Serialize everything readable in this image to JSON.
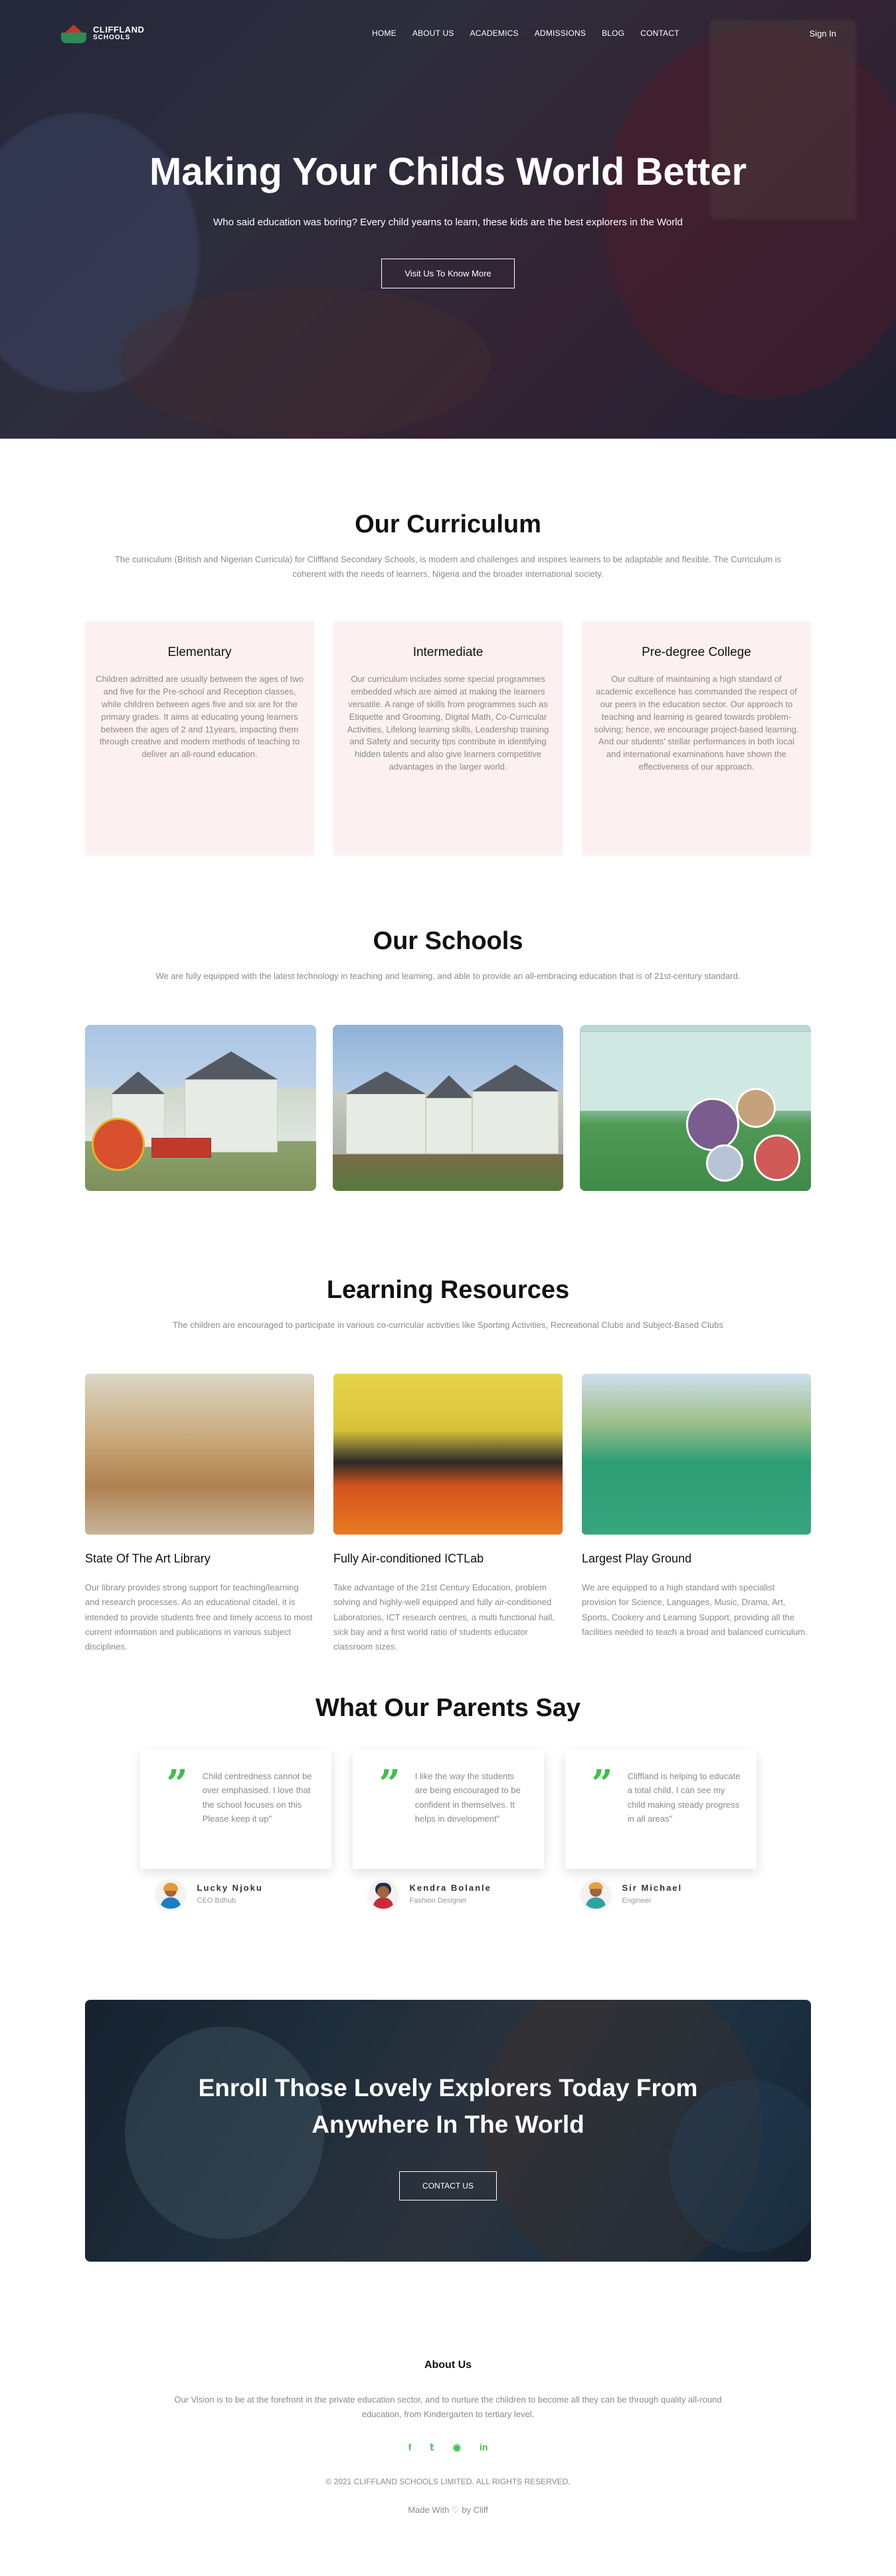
{
  "nav": {
    "logo_line1": "CLIFFLAND",
    "logo_line2": "SCHOOLS",
    "items": [
      "HOME",
      "ABOUT US",
      "ACADEMICS",
      "ADMISSIONS",
      "BLOG",
      "CONTACT"
    ],
    "signin": "Sign In"
  },
  "hero": {
    "title": "Making Your Childs World Better",
    "subtitle": "Who said education was boring? Every child yearns to learn, these kids are the best explorers in the World",
    "button": "Visit Us To Know More"
  },
  "curriculum": {
    "title": "Our Curriculum",
    "description": "The curriculum (British and Nigerian Curricula) for Cliffland Secondary Schools, is modern and challenges and inspires learners to be adaptable and flexible. The Curriculum is coherent with the needs of learners, Nigeria and the broader international society.",
    "cards": [
      {
        "title": "Elementary",
        "text": "Children admitted are usually between the ages of two and five for the Pre-school and Reception classes, while children between ages five and six are for the primary grades. It aims at educating young learners between the ages of 2 and 11years, impacting them through creative and modern methods of teaching to deliver an all-round education."
      },
      {
        "title": "Intermediate",
        "text": "Our curriculum includes some special programmes embedded which are aimed at making the learners versatile. A range of skills from programmes such as Etiquette and Grooming, Digital Math, Co-Curricular Activities, Lifelong learning skills, Leadership training and Safety and security tips contribute in identifying hidden talents and also give learners competitive advantages in the larger world."
      },
      {
        "title": "Pre-degree College",
        "text": "Our culture of maintaining a high standard of academic excellence has commanded the respect of our peers in the education sector. Our approach to teaching and learning is geared towards problem-solving; hence, we encourage project-based learning. And our students' stellar performances in both local and international examinations have shown the effectiveness of our approach."
      }
    ]
  },
  "schools": {
    "title": "Our Schools",
    "description": "We are fully equipped with the latest technology in teaching and learning, and able to provide an all-embracing education that is of 21st-century standard."
  },
  "resources": {
    "title": "Learning Resources",
    "description": "The children are encouraged to participate in various co-curricular activities like Sporting Activities, Recreational Clubs and Subject-Based Clubs",
    "items": [
      {
        "title": "State Of The Art Library",
        "text": "Our library provides strong support for teaching/learning and research processes. As an educational citadel, it is intended to provide students free and timely access to most current information and publications in various subject disciplines."
      },
      {
        "title": "Fully Air-conditioned ICTLab",
        "text": "Take advantage of the 21st Century Education, problem solving and highly-well equipped and fully air-conditioned Laboratories, ICT research centres, a multi functional hall, sick bay and a first world ratio of students educator classroom sizes."
      },
      {
        "title": "Largest Play Ground",
        "text": "We are equipped to a high standard with specialist provision for Science, Languages, Music, Drama, Art, Sports, Cookery and Learning Support, providing all the facilities needed to teach a broad and balanced curriculum."
      }
    ]
  },
  "parents": {
    "title": "What Our Parents Say",
    "testimonials": [
      {
        "quote": "Child centredness cannot be over emphasised. I love that the school focuses on this Please keep it up\"",
        "name": "Lucky Njoku",
        "role": "CEO Bdhub"
      },
      {
        "quote": "I like the way the students are being encouraged to be confident in themselves. It helps in development\"",
        "name": "Kendra Bolanle",
        "role": "Fashion Designer"
      },
      {
        "quote": "Cliffland is helping to educate a total child, I can see my child making steady progress in all areas\"",
        "name": "Sir Michael",
        "role": "Engineer"
      }
    ]
  },
  "enroll": {
    "title_line1": "Enroll Those Lovely Explorers Today From",
    "title_line2": "Anywhere In The World",
    "button": "CONTACT US"
  },
  "footer": {
    "title": "About Us",
    "text": "Our Vision is to be at the forefront in the private education sector, and to nurture the children to become all they can be through quality all-round education, from Kindergarten to tertiary level.",
    "socials": [
      "facebook-icon",
      "twitter-icon",
      "instagram-icon",
      "linkedin-icon"
    ],
    "copyright": "© 2021 CLIFFLAND SCHOOLS LIMITED. ALL RIGHTS RESERVED.",
    "made_prefix": "Made With",
    "made_suffix": "by Cliff"
  },
  "colors": {
    "accent": "#3fbf4a",
    "card_bg": "#fdf0f0"
  }
}
